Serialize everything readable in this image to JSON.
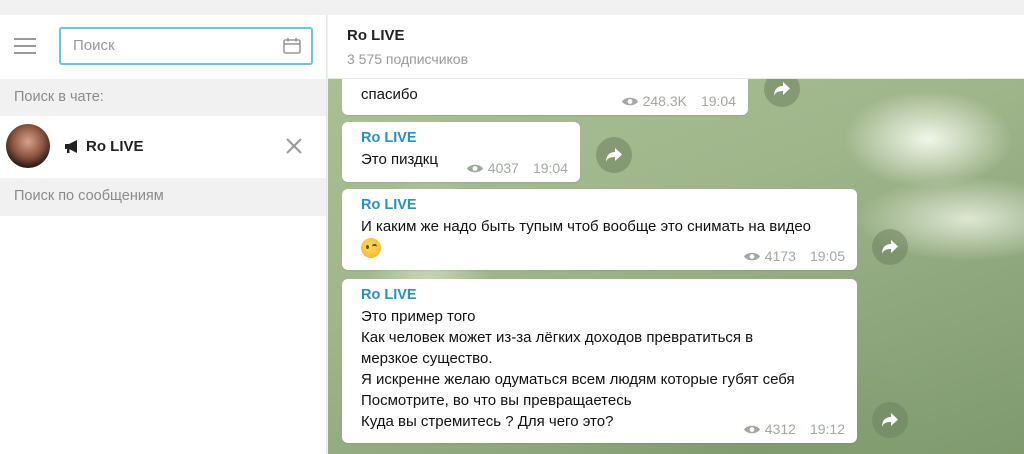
{
  "search": {
    "placeholder": "Поиск"
  },
  "sidebar": {
    "search_in_chat_label": "Поиск в чате:",
    "chat": {
      "name": "Ro LIVE"
    },
    "search_messages_label": "Поиск по сообщениям"
  },
  "header": {
    "title": "Ro LIVE",
    "subtitle": "3 575 подписчиков"
  },
  "messages": [
    {
      "author": "",
      "text": "спасибо",
      "views": "248.3K",
      "time": "19:04"
    },
    {
      "author": "Ro LIVE",
      "text": "Это пиздкц",
      "views": "4037",
      "time": "19:04"
    },
    {
      "author": "Ro LIVE",
      "text": "И каким же надо быть тупым чтоб вообще это снимать на видео",
      "views": "4173",
      "time": "19:05"
    },
    {
      "author": "Ro LIVE",
      "lines": [
        "Это пример того",
        "Как человек может из-за лёгких доходов превратиться в",
        "мерзкое существо.",
        "Я искренне желаю одуматься всем людям которые губят себя",
        "Посмотрите, во что вы превращаетесь",
        "Куда вы стремитесь ? Для чего это?"
      ],
      "views": "4312",
      "time": "19:12"
    }
  ],
  "icons": {
    "menu": "hamburger-menu-icon",
    "calendar": "calendar-icon",
    "channel": "megaphone-icon",
    "close": "close-icon",
    "views": "eye-icon",
    "forward": "forward-arrow-icon"
  },
  "colors": {
    "accent": "#6dc1e5",
    "author": "#2a8fc4"
  }
}
